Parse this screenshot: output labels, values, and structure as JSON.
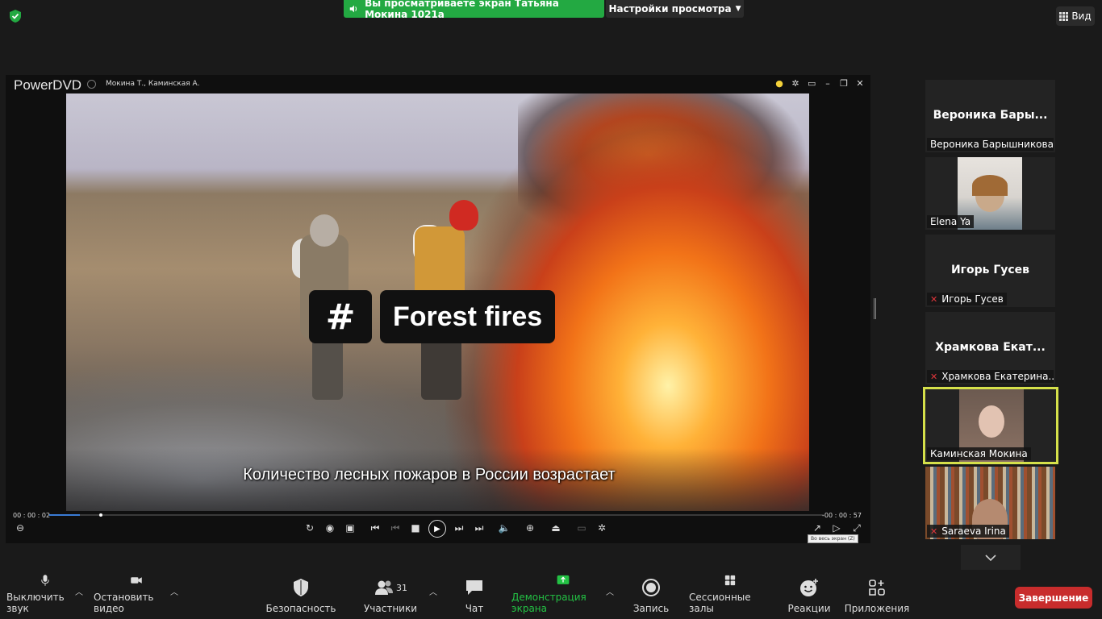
{
  "top_bar": {
    "share_banner": "Вы просматриваете экран Татьяна Мокина 1021а",
    "view_options": "Настройки просмотра",
    "view_button": "Вид"
  },
  "player": {
    "app_title": "PowerDVD",
    "file_title": "Мокина Т., Каминская А.",
    "video_tag_symbol": "#",
    "video_tag_text": "Forest fires",
    "subtitle": "Количество лесных пожаров в России возрастает",
    "time_elapsed": "00 : 00 : 02",
    "time_remaining": "-00 : 00 : 57",
    "progress_fraction": 0.04,
    "fullscreen_tooltip": "Во весь экран (Z)"
  },
  "participants": [
    {
      "big_name": "Вероника Бары...",
      "label": "Вероника Барышникова",
      "muted": false,
      "video": false
    },
    {
      "big_name": "",
      "label": "Elena Ya",
      "muted": false,
      "video": true
    },
    {
      "big_name": "Игорь Гусев",
      "label": "Игорь Гусев",
      "muted": true,
      "video": false
    },
    {
      "big_name": "Храмкова Екат...",
      "label": "Храмкова Екатерина...",
      "muted": true,
      "video": false
    },
    {
      "big_name": "",
      "label": "Каминская Мокина",
      "muted": false,
      "video": true,
      "active": true
    },
    {
      "big_name": "",
      "label": "Saraeva Irina",
      "muted": true,
      "video": true
    }
  ],
  "toolbar": {
    "mute": "Выключить звук",
    "stop_video": "Остановить видео",
    "security": "Безопасность",
    "participants": "Участники",
    "participants_count": "31",
    "chat": "Чат",
    "share_screen": "Демонстрация экрана",
    "record": "Запись",
    "breakout": "Сессионные залы",
    "reactions": "Реакции",
    "apps": "Приложения",
    "end": "Завершение"
  },
  "colors": {
    "share_green": "#23a942",
    "active_border": "#d5e04a",
    "end_red": "#c82c2c",
    "muted_red": "#e0363c"
  }
}
